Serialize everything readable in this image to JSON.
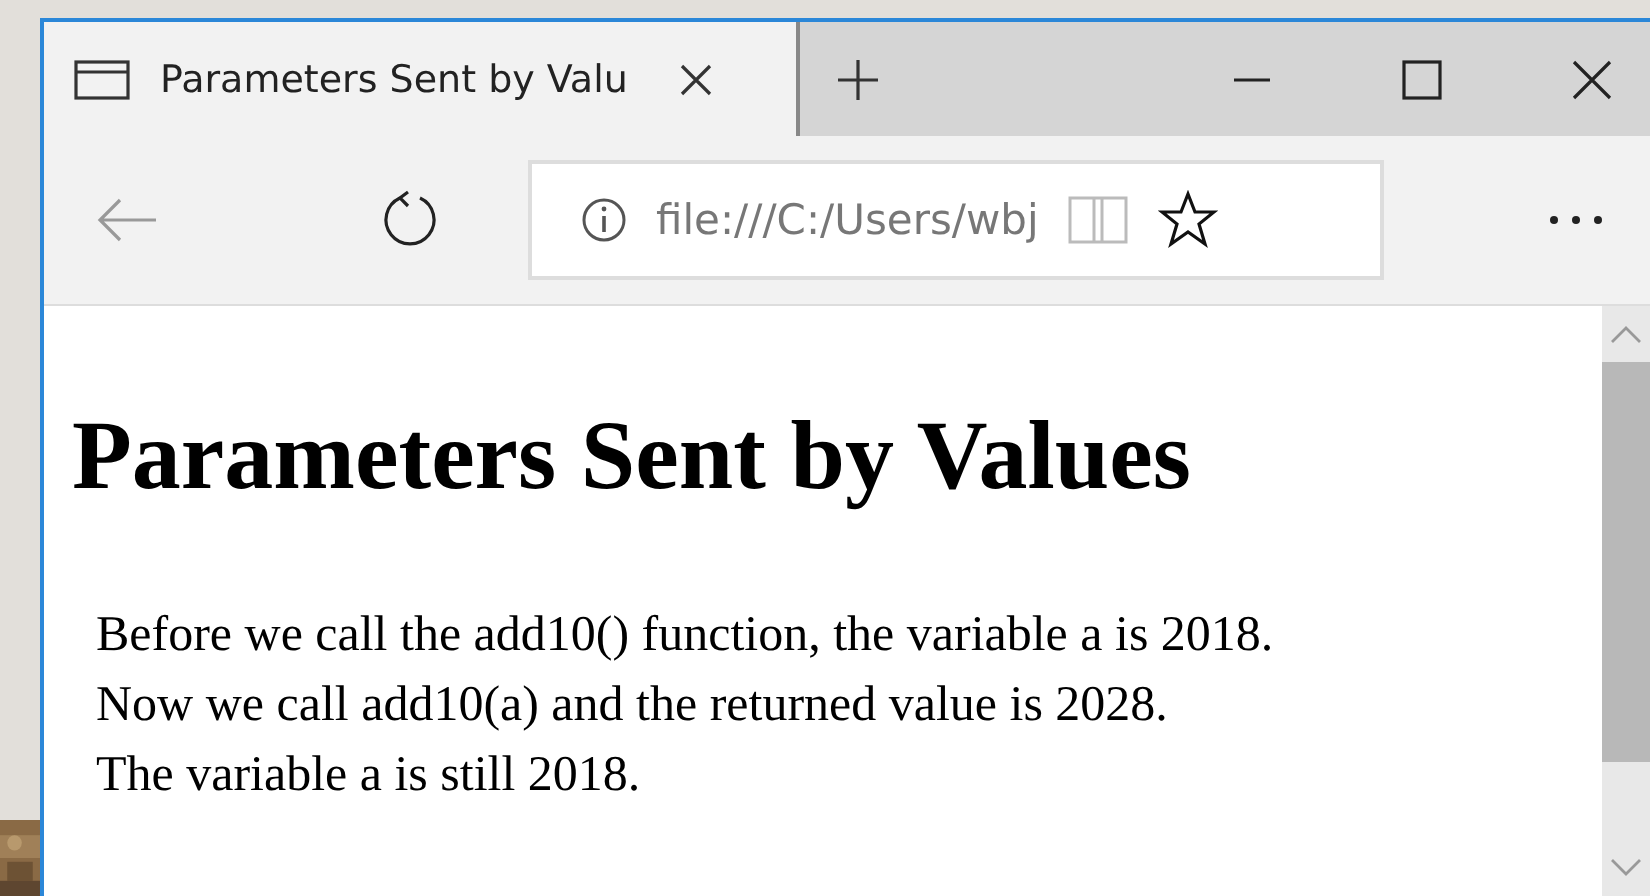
{
  "tab": {
    "title": "Parameters Sent by Valu",
    "selected": true
  },
  "address": {
    "value": "file:///C:/Users/wbj"
  },
  "page": {
    "heading": "Parameters Sent by Values",
    "lines": [
      "Before we call the add10() function, the variable a is 2018.",
      "Now we call add10(a) and the returned value is 2028.",
      "The variable a is still 2018."
    ]
  }
}
